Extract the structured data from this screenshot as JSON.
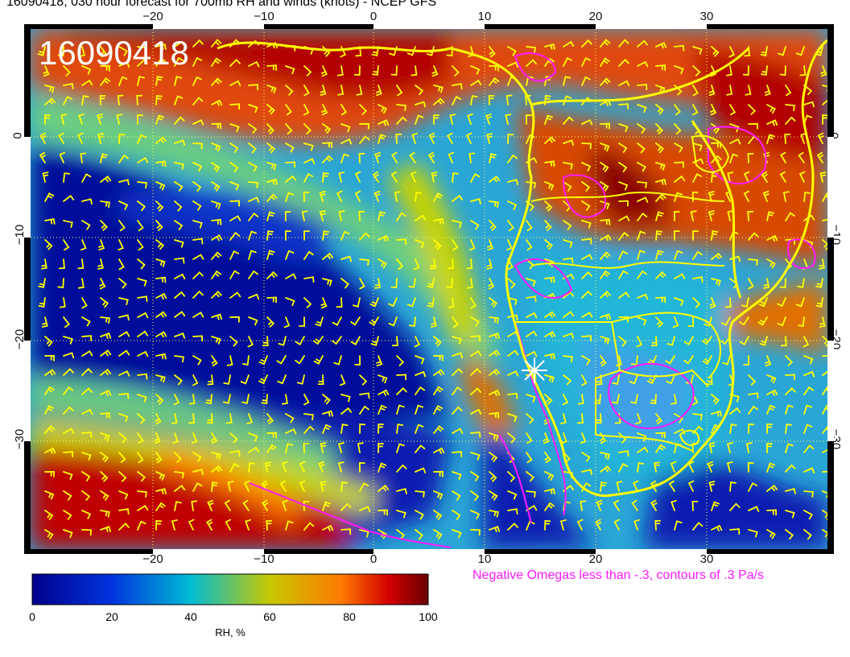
{
  "title": "16090418, 030 hour forecast for 700mb RH and winds (knots) - NCEP GFS",
  "map_stamp": "16090418",
  "lon_labels": [
    "−20",
    "−10",
    "0",
    "10",
    "20",
    "30"
  ],
  "lat_labels": [
    "0",
    "−10",
    "−20",
    "−30"
  ],
  "colorbar": {
    "ticks": [
      "0",
      "20",
      "40",
      "60",
      "80",
      "100"
    ],
    "unit": "RH, %",
    "colors": [
      "#00008b",
      "#0033dd",
      "#00bcd4",
      "#c8c800",
      "#ff7a00",
      "#d40000",
      "#6b0000"
    ]
  },
  "omega_note": "Negative Omegas less than -.3, contours of .3 Pa/s",
  "colors": {
    "coastline": "#ffff00",
    "omega_contour": "#ff1aff",
    "wind_barb": "#ffff00"
  },
  "marker": "star-marker"
}
